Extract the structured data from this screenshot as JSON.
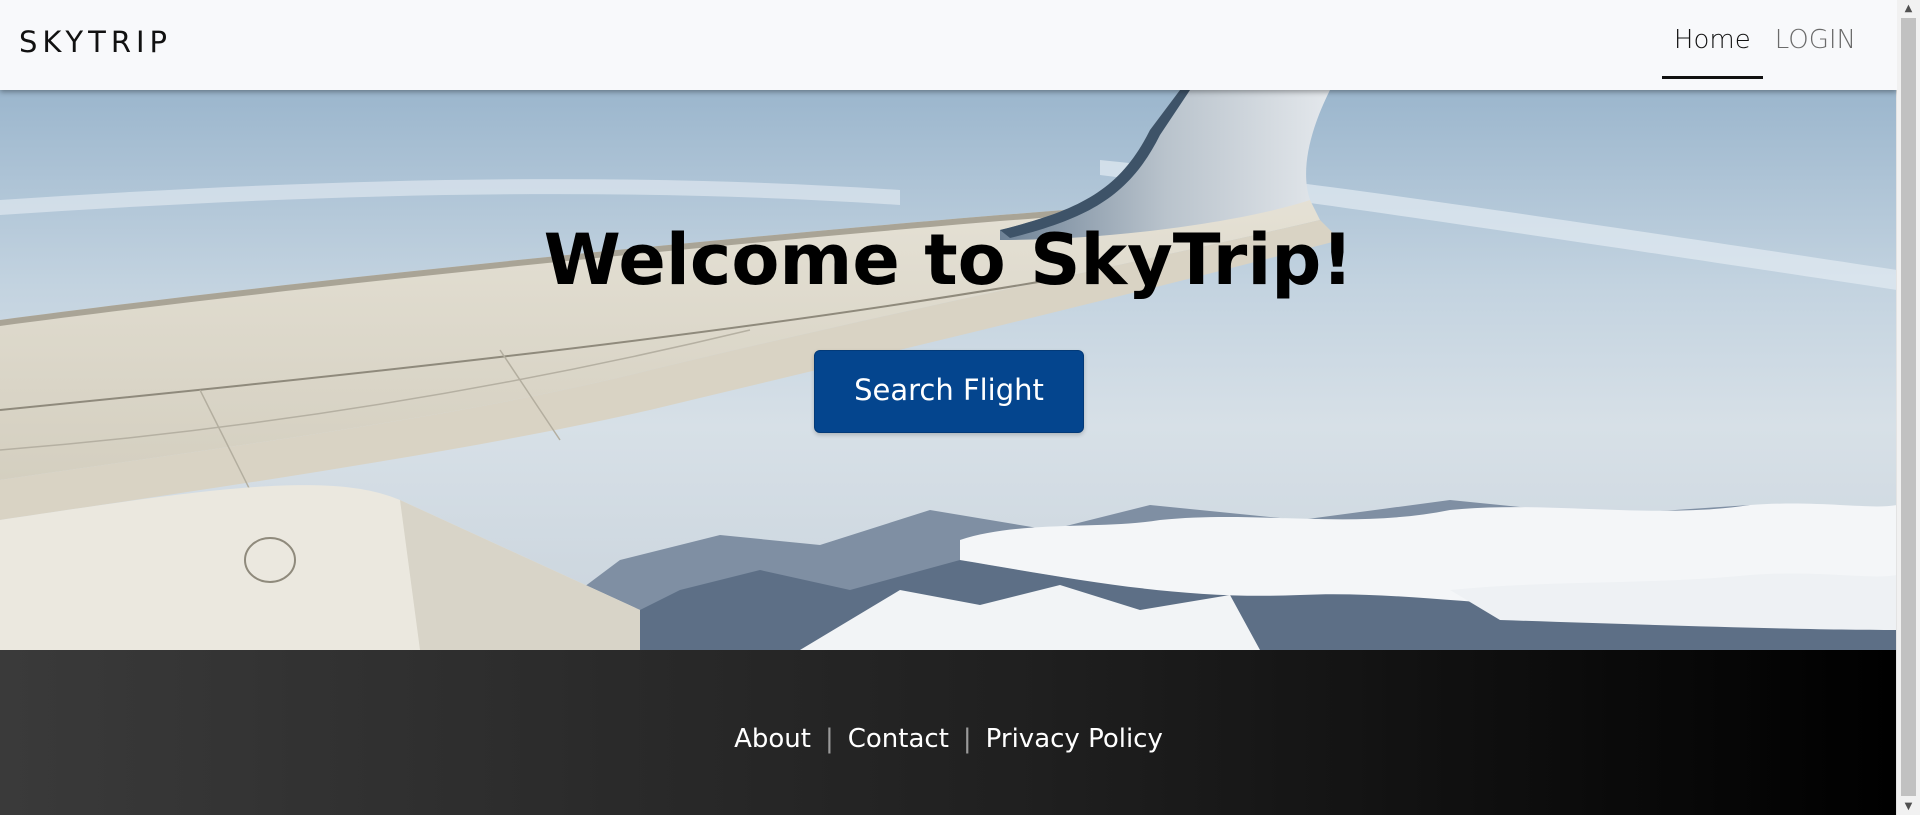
{
  "navbar": {
    "brand": "SKYTRIP",
    "links": [
      {
        "label": "Home",
        "active": true
      },
      {
        "label": "LOGIN",
        "active": false
      }
    ]
  },
  "hero": {
    "title": "Welcome to SkyTrip!",
    "button_label": "Search Flight",
    "button_color": "#04458e"
  },
  "footer": {
    "links": [
      "About",
      "Contact",
      "Privacy Policy"
    ],
    "separator": "|"
  },
  "scrollbar": {
    "up_icon": "chevron-up-icon",
    "down_icon": "chevron-down-icon"
  }
}
